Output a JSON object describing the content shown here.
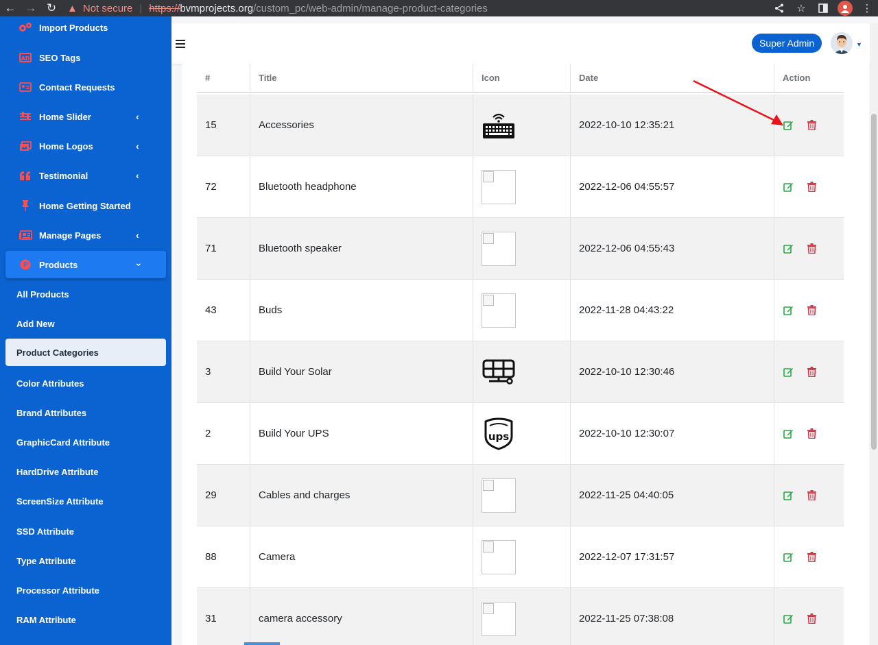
{
  "browser": {
    "security_label": "Not secure",
    "url_scheme": "https://",
    "url_host": "bvmprojects.org",
    "url_path": "/custom_pc/web-admin/manage-product-categories"
  },
  "sidebar": {
    "items": [
      {
        "label": "Import Products",
        "icon": "gears-icon"
      },
      {
        "label": "SEO Tags",
        "icon": "ad-icon"
      },
      {
        "label": "Contact Requests",
        "icon": "id-card-icon"
      },
      {
        "label": "Home Slider",
        "icon": "sliders-icon"
      },
      {
        "label": "Home Logos",
        "icon": "images-icon"
      },
      {
        "label": "Testimonial",
        "icon": "quote-icon"
      },
      {
        "label": "Home Getting Started",
        "icon": "thumbtack-icon"
      },
      {
        "label": "Manage Pages",
        "icon": "newspaper-icon"
      },
      {
        "label": "Products",
        "icon": "product-hunt-icon"
      }
    ],
    "sub_items": [
      "All Products",
      "Add New",
      "Product Categories",
      "Color Attributes",
      "Brand Attributes",
      "GraphicCard Attribute",
      "HardDrive Attribute",
      "ScreenSize Attribute",
      "SSD Attribute",
      "Type Attribute",
      "Processor Attribute",
      "RAM Attribute"
    ],
    "selected_sub": "Product Categories"
  },
  "header": {
    "user_label": "Super Admin"
  },
  "table": {
    "columns": [
      "#",
      "Title",
      "Icon",
      "Date",
      "Action"
    ],
    "rows": [
      {
        "id": "15",
        "title": "Accessories",
        "icon": "keyboard-icon",
        "date": "2022-10-10 12:35:21"
      },
      {
        "id": "72",
        "title": "Bluetooth headphone",
        "icon": "broken-image",
        "date": "2022-12-06 04:55:57"
      },
      {
        "id": "71",
        "title": "Bluetooth speaker",
        "icon": "broken-image",
        "date": "2022-12-06 04:55:43"
      },
      {
        "id": "43",
        "title": "Buds",
        "icon": "broken-image",
        "date": "2022-11-28 04:43:22"
      },
      {
        "id": "3",
        "title": "Build Your Solar",
        "icon": "solar-panel-icon",
        "date": "2022-10-10 12:30:46"
      },
      {
        "id": "2",
        "title": "Build Your UPS",
        "icon": "ups-logo-icon",
        "date": "2022-10-10 12:30:07"
      },
      {
        "id": "29",
        "title": "Cables and charges",
        "icon": "broken-image",
        "date": "2022-11-25 04:40:05"
      },
      {
        "id": "88",
        "title": "Camera",
        "icon": "broken-image",
        "date": "2022-12-07 17:31:57"
      },
      {
        "id": "31",
        "title": "camera accessory",
        "icon": "broken-image",
        "date": "2022-11-25 07:38:08"
      }
    ]
  },
  "colors": {
    "sidebar_bg": "#0b63d1",
    "sidebar_icon": "#ff4d4d",
    "edit_green": "#28a745",
    "delete_red": "#dc3545",
    "annotation_arrow": "#e8141a"
  }
}
